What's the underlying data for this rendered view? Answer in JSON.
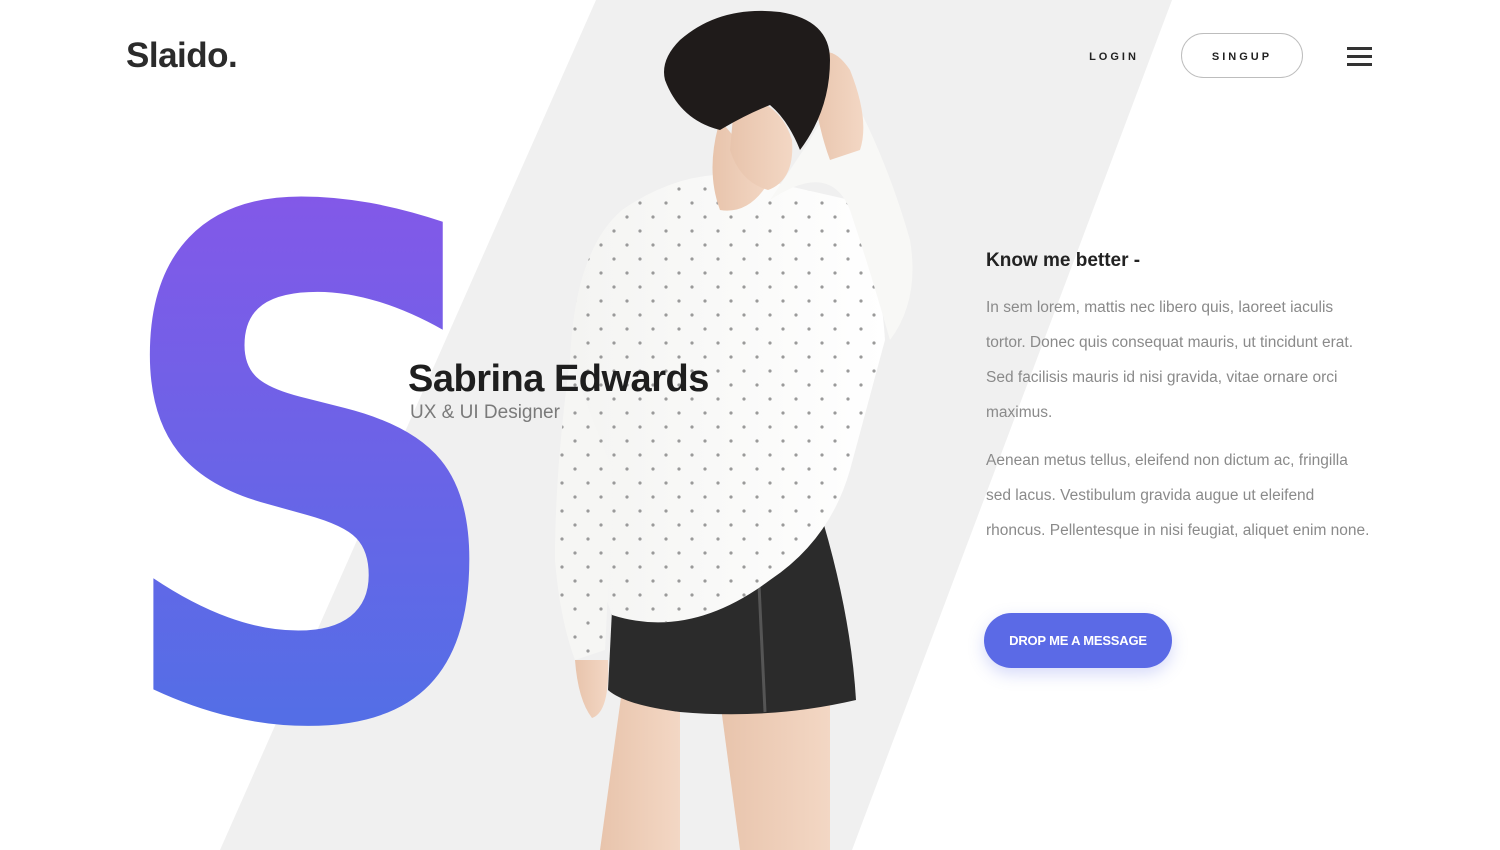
{
  "header": {
    "logo": "Slaido.",
    "login_label": "LOGIN",
    "signup_label": "SINGUP",
    "menu_icon": "hamburger-menu-icon"
  },
  "hero": {
    "letter": "S",
    "name": "Sabrina Edwards",
    "role": "UX & UI Designer",
    "image": "model-photo"
  },
  "about": {
    "title": "Know me better -",
    "paragraphs": [
      "In sem lorem, mattis nec libero quis, laoreet iaculis tortor. Donec quis consequat mauris, ut tincidunt erat. Sed facilisis mauris id nisi gravida, vitae ornare orci maximus.",
      "Aenean metus tellus, eleifend non dictum ac, fringilla sed lacus. Vestibulum gravida augue ut eleifend rhoncus. Pellentesque in nisi feugiat, aliquet enim none."
    ],
    "cta_label": "DROP ME A MESSAGE"
  },
  "colors": {
    "gradient_top": "#8e53e8",
    "gradient_bottom": "#4575e6",
    "accent": "#5b6ae6",
    "band": "#f0f0f0",
    "text_dark": "#222222",
    "text_muted": "#8a8a8a"
  }
}
